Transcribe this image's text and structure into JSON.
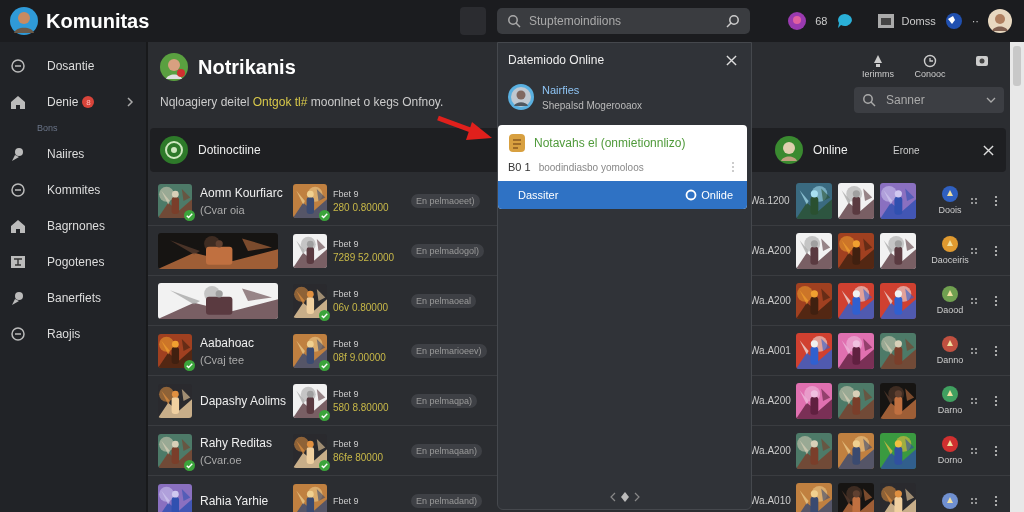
{
  "app": {
    "title": "Komunitas"
  },
  "topbar": {
    "search": {
      "placeholder": "Stuptemoindiions"
    },
    "count": "68",
    "box_label": "Domss",
    "dots": "··"
  },
  "sidebar": {
    "items": [
      {
        "kind": "item",
        "label": "Dosantie",
        "expandable": false
      },
      {
        "kind": "item",
        "label": "Denie",
        "badge": "8",
        "expandable": true
      },
      {
        "kind": "caption",
        "label": "Bons"
      },
      {
        "kind": "item",
        "label": "Naiires",
        "expandable": false
      },
      {
        "kind": "item",
        "label": "Kommites",
        "expandable": false
      },
      {
        "kind": "item",
        "label": "Bagrnones",
        "expandable": false
      },
      {
        "kind": "item",
        "label": "Pogotenes",
        "expandable": false
      },
      {
        "kind": "item",
        "label": "Banerfiets",
        "expandable": false
      },
      {
        "kind": "item",
        "label": "Raojis",
        "expandable": false
      }
    ]
  },
  "page": {
    "title": "Notrikanis",
    "description": [
      {
        "text": "Nqloagiery deitel ",
        "highlight": false
      },
      {
        "text": "Ontgok tl#",
        "highlight": true
      },
      {
        "text": " moonlnet o kegs Onfnoy.",
        "highlight": false
      }
    ],
    "actions": [
      {
        "kind": "bell",
        "label": "Ierimms"
      },
      {
        "kind": "clock",
        "label": "Conooc"
      },
      {
        "kind": "camera"
      }
    ],
    "filter": {
      "placeholder": "Sanner"
    },
    "group_bar": {
      "title": "Dotinoctiine",
      "status": "Online",
      "extra": "Erone"
    },
    "rows": [
      {
        "kind": "titled",
        "name": "Aomn Kourfiarc",
        "subtitle": "(Cvar oia",
        "thumb_verified": true,
        "game_verified": true,
        "game": "Fbet 9",
        "code": "280 0.80000",
        "tag": "En pelmaoeet)",
        "date": "Wa.1200",
        "emblem_label": "Doois"
      },
      {
        "kind": "banner",
        "thumb_verified": false,
        "game_verified": false,
        "game": "Fbet 9",
        "code": "7289 52.0000",
        "tag": "En pelmadogol)",
        "date": "Wa.A200",
        "emblem_label": "Daoceiris"
      },
      {
        "kind": "banner",
        "thumb_verified": false,
        "game_verified": true,
        "game": "Fbet 9",
        "code": "06v 0.80000",
        "tag": "En pelmaoeal",
        "date": "Wa.A200",
        "emblem_label": "Daood"
      },
      {
        "kind": "titled",
        "name": "Aabahoac",
        "subtitle": "(Cvaj tee",
        "thumb_verified": true,
        "game_verified": true,
        "game": "Fbet 9",
        "code": "08f 9.00000",
        "tag": "En pelmarioeev)",
        "date": "Wa.A001",
        "emblem_label": "Danno"
      },
      {
        "kind": "titled",
        "name": "Dapashy Aolims",
        "thumb_verified": false,
        "game_verified": true,
        "game": "Fbet 9",
        "code": "580 8.80000",
        "tag": "En pelmaqpa)",
        "date": "Wa.A200",
        "emblem_label": "Darno"
      },
      {
        "kind": "titled",
        "name": "Rahy Reditas",
        "subtitle": "(Cvar.oe",
        "thumb_verified": true,
        "game_verified": true,
        "game": "Fbet 9",
        "code": "86fe 80000",
        "tag": "En pelmaqaan)",
        "date": "Wa.A200",
        "emblem_label": "Dorno"
      },
      {
        "kind": "titled",
        "name": "Rahia Yarhie",
        "thumb_verified": false,
        "game_verified": false,
        "game": "Fbet 9",
        "tag": "En pelmadand)",
        "date": "Wa.A010"
      }
    ]
  },
  "popup": {
    "title": "Datemiodo Online",
    "user": {
      "name": "Nairfies",
      "subtitle": "Shepalsd Mogerooaox"
    },
    "card": {
      "title": "Notavahs el (onmietionnlizo)",
      "code": "B0 1",
      "text": "boodindiasbo yomoloos",
      "left_action": "Dassiter",
      "right_action": "Onlide"
    }
  }
}
